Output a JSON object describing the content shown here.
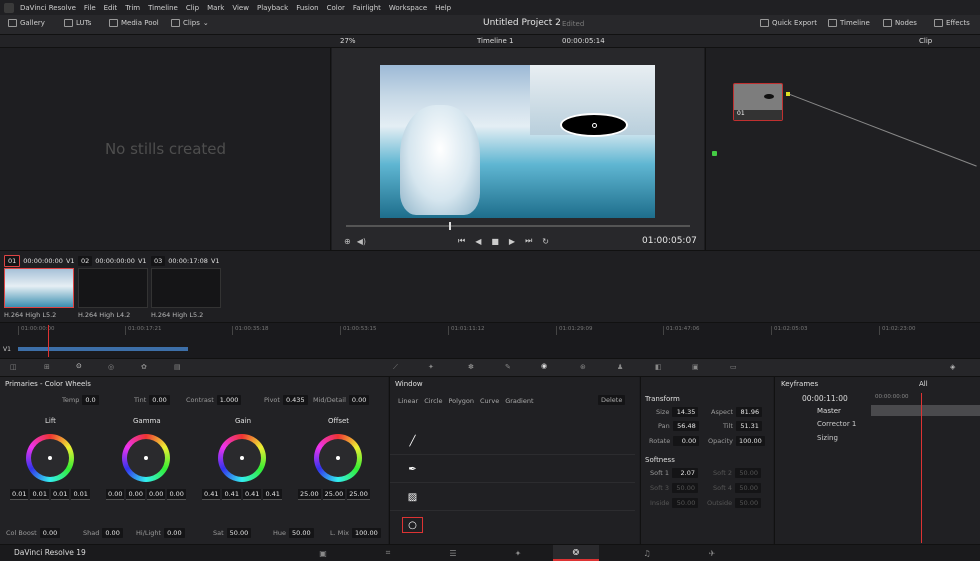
{
  "app": {
    "name": "DaVinci Resolve",
    "footer_name": "DaVinci Resolve 19"
  },
  "menu": [
    "DaVinci Resolve",
    "File",
    "Edit",
    "Trim",
    "Timeline",
    "Clip",
    "Mark",
    "View",
    "Playback",
    "Fusion",
    "Color",
    "Fairlight",
    "Workspace",
    "Help"
  ],
  "toolbar": {
    "gallery": "Gallery",
    "luts": "LUTs",
    "media_pool": "Media Pool",
    "clips": "Clips",
    "project_title": "Untitled Project 2",
    "edited": "Edited",
    "quick_export": "Quick Export",
    "timeline": "Timeline",
    "nodes": "Nodes",
    "effects": "Effects"
  },
  "subtoolbar": {
    "zoom": "27%",
    "timeline_name": "Timeline 1",
    "timecode": "00:00:05:14",
    "clip_mode": "Clip"
  },
  "gallery": {
    "empty_text": "No stills created"
  },
  "viewer": {
    "timecode": "01:00:05:07"
  },
  "node": {
    "label": "01"
  },
  "clips": [
    {
      "num": "01",
      "tc": "00:00:00:00",
      "track": "V1",
      "codec": "H.264 High L5.2"
    },
    {
      "num": "02",
      "tc": "00:00:00:00",
      "track": "V1",
      "codec": "H.264 High L4.2"
    },
    {
      "num": "03",
      "tc": "00:00:17:08",
      "track": "V1",
      "codec": "H.264 High L5.2"
    }
  ],
  "ruler": {
    "ticks": [
      "01:00:00:00",
      "01:00:17:21",
      "01:00:35:18",
      "01:00:53:15",
      "01:01:11:12",
      "01:01:29:09",
      "01:01:47:06",
      "01:02:05:03",
      "01:02:23:00"
    ],
    "track": "V1"
  },
  "primaries": {
    "title": "Primaries - Color Wheels",
    "temp_label": "Temp",
    "temp": "0.0",
    "tint_label": "Tint",
    "tint": "0.00",
    "contrast_label": "Contrast",
    "contrast": "1.000",
    "pivot_label": "Pivot",
    "pivot": "0.435",
    "middetail_label": "Mid/Detail",
    "middetail": "0.00",
    "wheels": [
      {
        "name": "Lift",
        "values": [
          "0.01",
          "0.01",
          "0.01",
          "0.01"
        ]
      },
      {
        "name": "Gamma",
        "values": [
          "0.00",
          "0.00",
          "0.00",
          "0.00"
        ]
      },
      {
        "name": "Gain",
        "values": [
          "0.41",
          "0.41",
          "0.41",
          "0.41"
        ]
      },
      {
        "name": "Offset",
        "values": [
          "25.00",
          "25.00",
          "25.00"
        ]
      }
    ],
    "colboost_label": "Col Boost",
    "colboost": "0.00",
    "shad_label": "Shad",
    "shad": "0.00",
    "hilight_label": "Hi/Light",
    "hilight": "0.00",
    "sat_label": "Sat",
    "sat": "50.00",
    "hue_label": "Hue",
    "hue": "50.00",
    "lmix_label": "L. Mix",
    "lmix": "100.00"
  },
  "window": {
    "title": "Window",
    "tools": [
      "Linear",
      "Circle",
      "Polygon",
      "Curve",
      "Gradient"
    ],
    "delete": "Delete"
  },
  "transform": {
    "title": "Transform",
    "size_label": "Size",
    "size": "14.35",
    "aspect_label": "Aspect",
    "aspect": "81.96",
    "pan_label": "Pan",
    "pan": "56.48",
    "tilt_label": "Tilt",
    "tilt": "51.31",
    "rotate_label": "Rotate",
    "rotate": "0.00",
    "opacity_label": "Opacity",
    "opacity": "100.00",
    "softness_title": "Softness",
    "soft1_label": "Soft 1",
    "soft1": "2.07",
    "soft2_label": "Soft 2",
    "soft2": "50.00",
    "soft3_label": "Soft 3",
    "soft3": "50.00",
    "soft4_label": "Soft 4",
    "soft4": "50.00",
    "inside_label": "Inside",
    "inside": "50.00",
    "outside_label": "Outside",
    "outside": "50.00"
  },
  "keyframes": {
    "title": "Keyframes",
    "filter": "All",
    "timecode": "00:00:11:00",
    "ruler_tc": "00:00:00:00",
    "rows": [
      "Master",
      "Corrector 1",
      "Sizing"
    ]
  }
}
